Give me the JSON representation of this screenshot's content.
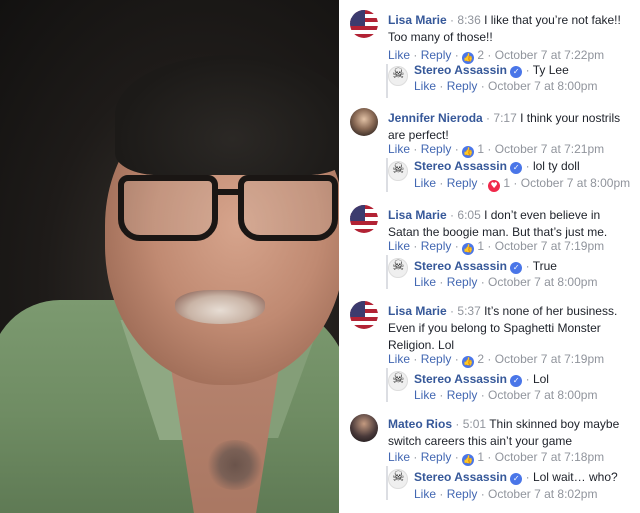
{
  "comments": [
    {
      "name": "Lisa Marie",
      "timestamp": "8:36",
      "text": "I like that you’re not fake!! Too many of those!!",
      "avatar": "flag-icon",
      "actions": {
        "like": "Like",
        "reply": "Reply",
        "reactions": "2",
        "date": "October 7 at 7:22pm"
      },
      "reply": {
        "name": "Stereo Assassin",
        "text": "Ty Lee",
        "actions": {
          "like": "Like",
          "reply": "Reply",
          "date": "October 7 at 8:00pm"
        }
      }
    },
    {
      "name": "Jennifer Nieroda",
      "timestamp": "7:17",
      "text": "I think your nostrils are perfect!",
      "avatar": "profile-photo",
      "actions": {
        "like": "Like",
        "reply": "Reply",
        "reactions": "1",
        "date": "October 7 at 7:21pm"
      },
      "reply": {
        "name": "Stereo Assassin",
        "text": "lol ty doll",
        "actions": {
          "like": "Like",
          "reply": "Reply",
          "reactions": "1",
          "date": "October 7 at 8:00pm"
        }
      }
    },
    {
      "name": "Lisa Marie",
      "timestamp": "6:05",
      "text": "I don’t even believe in Satan the boogie man. But that’s just me.",
      "avatar": "flag-icon",
      "actions": {
        "like": "Like",
        "reply": "Reply",
        "reactions": "1",
        "date": "October 7 at 7:19pm"
      },
      "reply": {
        "name": "Stereo Assassin",
        "text": "True",
        "actions": {
          "like": "Like",
          "reply": "Reply",
          "date": "October 7 at 8:00pm"
        }
      }
    },
    {
      "name": "Lisa Marie",
      "timestamp": "5:37",
      "text": "It’s none of her business. Even if you belong to Spaghetti Monster Religion. Lol",
      "avatar": "flag-icon",
      "actions": {
        "like": "Like",
        "reply": "Reply",
        "reactions": "2",
        "date": "October 7 at 7:19pm"
      },
      "reply": {
        "name": "Stereo Assassin",
        "text": "Lol",
        "actions": {
          "like": "Like",
          "reply": "Reply",
          "date": "October 7 at 8:00pm"
        }
      }
    },
    {
      "name": "Mateo Rios",
      "timestamp": "5:01",
      "text": "Thin skinned boy maybe switch careers this ain’t your game",
      "avatar": "profile-photo",
      "actions": {
        "like": "Like",
        "reply": "Reply",
        "reactions": "1",
        "date": "October 7 at 7:18pm"
      },
      "reply": {
        "name": "Stereo Assassin",
        "text": "Lol wait… who?",
        "actions": {
          "like": "Like",
          "reply": "Reply",
          "date": "October 7 at 8:02pm"
        }
      }
    }
  ],
  "colors": {
    "link": "#365899",
    "meta": "#90949c",
    "like_blue": "#4a76e8",
    "heart_red": "#f0284a"
  },
  "separator": "·"
}
